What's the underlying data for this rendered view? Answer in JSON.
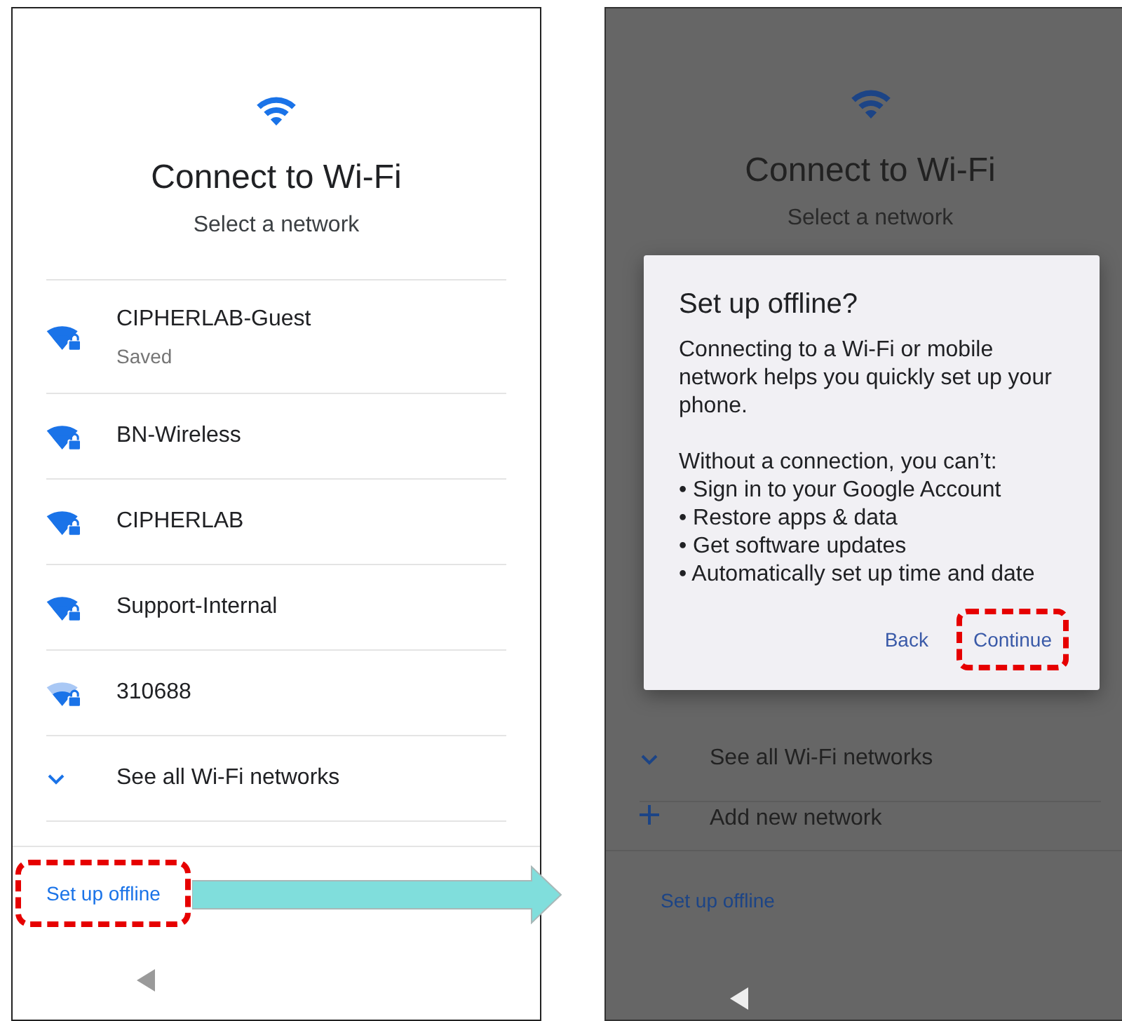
{
  "screens": [
    {
      "dimmed": false,
      "title": "Connect to Wi-Fi",
      "subtitle": "Select a network",
      "networks": [
        {
          "name": "CIPHERLAB-Guest",
          "status": "Saved",
          "weak_signal": false
        },
        {
          "name": "BN-Wireless",
          "weak_signal": false
        },
        {
          "name": "CIPHERLAB",
          "weak_signal": false
        },
        {
          "name": "Support-Internal",
          "weak_signal": false
        },
        {
          "name": "310688",
          "weak_signal": true
        }
      ],
      "actions": [
        {
          "kind": "expand",
          "label": "See all Wi-Fi networks"
        }
      ],
      "offline_link": {
        "label": "Set up offline",
        "highlighted": true
      }
    },
    {
      "dimmed": true,
      "title": "Connect to Wi-Fi",
      "subtitle": "Select a network",
      "actions": [
        {
          "kind": "expand",
          "label": "See all Wi-Fi networks"
        },
        {
          "kind": "add",
          "label": "Add new network"
        }
      ],
      "offline_link": {
        "label": "Set up offline",
        "highlighted": false
      },
      "dialog": {
        "title": "Set up offline?",
        "body": "Connecting to a Wi-Fi or mobile network helps you quickly set up your phone.",
        "list_heading": "Without a connection, you can’t:",
        "bullets": [
          "• Sign in to your Google Account",
          "• Restore apps & data",
          "• Get software updates",
          "• Automatically set up time and date"
        ],
        "buttons": [
          {
            "label": "Back",
            "highlighted": false
          },
          {
            "label": "Continue",
            "highlighted": true
          }
        ]
      }
    }
  ]
}
